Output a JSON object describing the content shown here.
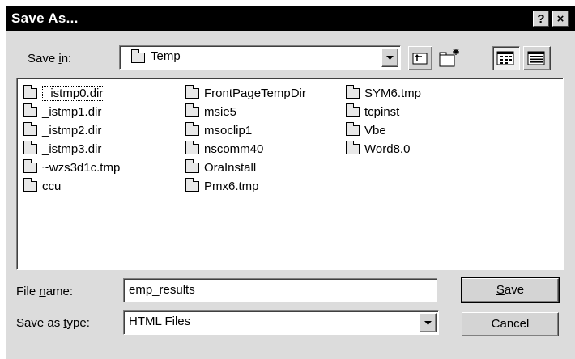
{
  "window": {
    "title": "Save As...",
    "help_glyph": "?",
    "close_glyph": "×"
  },
  "save_in": {
    "label_pre": "Save ",
    "label_underline": "i",
    "label_post": "n:",
    "value": "Temp"
  },
  "toolbar": {
    "up_folder_icon": "up-one-level-icon",
    "new_folder_icon": "create-new-folder-icon",
    "list_view_icon": "list-view-icon",
    "details_view_icon": "details-view-icon"
  },
  "files": [
    {
      "name": "_istmp0.dir",
      "selected": true
    },
    {
      "name": "_istmp1.dir"
    },
    {
      "name": "_istmp2.dir"
    },
    {
      "name": "_istmp3.dir"
    },
    {
      "name": "~wzs3d1c.tmp"
    },
    {
      "name": "ccu"
    },
    {
      "name": "FrontPageTempDir"
    },
    {
      "name": "msie5"
    },
    {
      "name": "msoclip1"
    },
    {
      "name": "nscomm40"
    },
    {
      "name": "OraInstall"
    },
    {
      "name": "Pmx6.tmp"
    },
    {
      "name": "SYM6.tmp"
    },
    {
      "name": "tcpinst"
    },
    {
      "name": "Vbe"
    },
    {
      "name": "Word8.0"
    }
  ],
  "file_name": {
    "label_pre": "File ",
    "label_underline": "n",
    "label_post": "ame:",
    "value": "emp_results"
  },
  "save_as_type": {
    "label_pre": "Save as ",
    "label_underline": "t",
    "label_post": "ype:",
    "value": "HTML Files"
  },
  "buttons": {
    "save_underline": "S",
    "save_rest": "ave",
    "cancel": "Cancel"
  },
  "colors": {
    "title_bar": "#000000",
    "dialog_face": "#dcdcdc",
    "window_bg": "#ffffff"
  }
}
